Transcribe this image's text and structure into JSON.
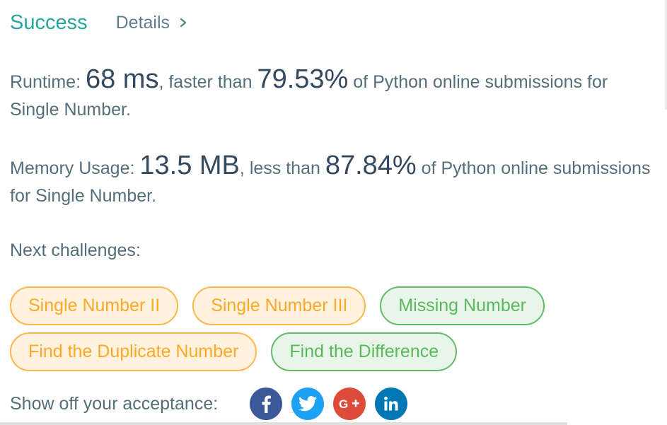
{
  "result": {
    "status": "Success",
    "details_label": "Details"
  },
  "runtime": {
    "label": "Runtime: ",
    "value": "68 ms",
    "comparison": ", faster than ",
    "percent": "79.53%",
    "suffix": " of Python online submissions for",
    "line2": "Single Number."
  },
  "memory": {
    "label": "Memory Usage: ",
    "value": "13.5 MB",
    "comparison": ", less than ",
    "percent": "87.84%",
    "suffix": " of Python online submissions",
    "line2": "for Single Number."
  },
  "next_challenges": {
    "label": "Next challenges:",
    "items": [
      {
        "label": "Single Number II",
        "difficulty": "medium"
      },
      {
        "label": "Single Number III",
        "difficulty": "medium"
      },
      {
        "label": "Missing Number",
        "difficulty": "easy"
      },
      {
        "label": "Find the Duplicate Number",
        "difficulty": "medium"
      },
      {
        "label": "Find the Difference",
        "difficulty": "easy"
      }
    ]
  },
  "share": {
    "label": "Show off your acceptance:",
    "networks": [
      {
        "name": "facebook-icon",
        "glyph": "f",
        "color": "#3b5998"
      },
      {
        "name": "twitter-icon",
        "glyph": "",
        "color": "#1da1f2"
      },
      {
        "name": "google-plus-icon",
        "glyph": "G+",
        "color": "#dd4b39"
      },
      {
        "name": "linkedin-icon",
        "glyph": "in",
        "color": "#0077b5"
      }
    ]
  },
  "colors": {
    "success": "#26a69a",
    "medium": "#ffa726",
    "easy": "#5cb85c"
  }
}
